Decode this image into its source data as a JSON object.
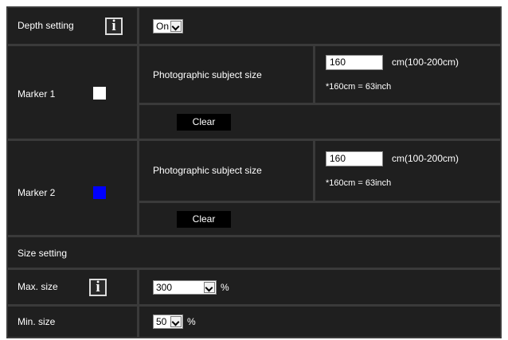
{
  "depth_setting": {
    "label": "Depth setting",
    "info_icon": "i",
    "value": "On"
  },
  "marker1": {
    "label": "Marker 1",
    "swatch_color": "#ffffff",
    "subject_label": "Photographic subject size",
    "size_value": "160",
    "unit": "cm(100-200cm)",
    "note": "*160cm = 63inch",
    "clear_label": "Clear"
  },
  "marker2": {
    "label": "Marker 2",
    "swatch_color": "#0000ff",
    "subject_label": "Photographic subject size",
    "size_value": "160",
    "unit": "cm(100-200cm)",
    "note": "*160cm = 63inch",
    "clear_label": "Clear"
  },
  "size_setting": {
    "label": "Size setting"
  },
  "max_size": {
    "label": "Max. size",
    "info_icon": "i",
    "value": "300",
    "unit": "%"
  },
  "min_size": {
    "label": "Min. size",
    "value": "50",
    "unit": "%"
  }
}
